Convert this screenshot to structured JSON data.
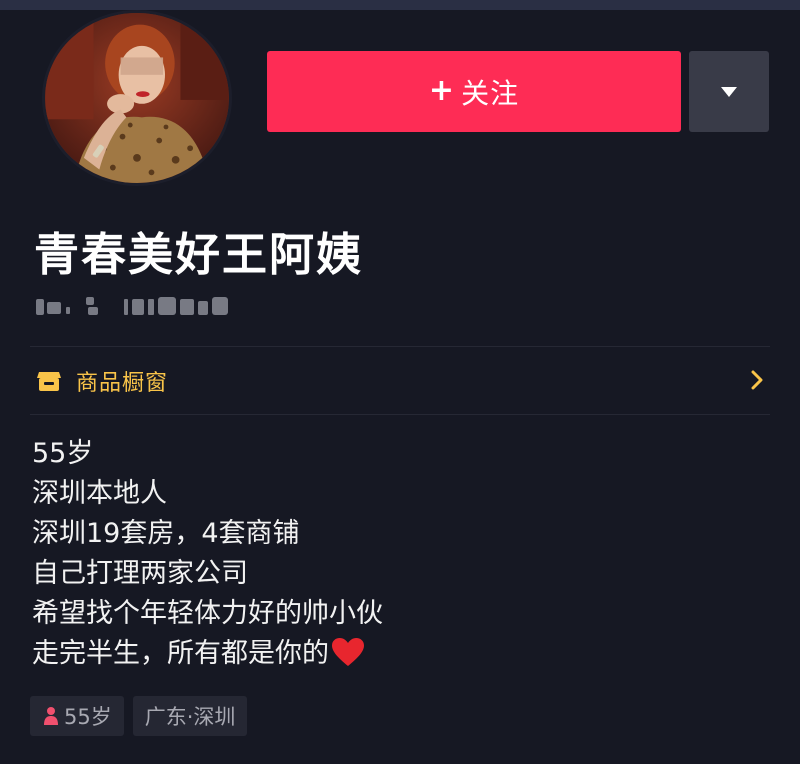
{
  "profile": {
    "nickname": "青春美好王阿姨",
    "avatar_icon": "user-avatar-photo",
    "id_blurred": true
  },
  "actions": {
    "follow_plus": "+",
    "follow_label": "关注",
    "more_icon": "caret-down-icon"
  },
  "shop": {
    "icon": "storefront-icon",
    "label": "商品橱窗",
    "arrow_icon": "chevron-right-icon"
  },
  "bio": {
    "lines": [
      "55岁",
      "深圳本地人",
      "深圳19套房，4套商铺",
      "自己打理两家公司",
      "希望找个年轻体力好的帅小伙",
      "走完半生，所有都是你的"
    ],
    "trailing_emoji": "heart-icon"
  },
  "tags": {
    "age": "55岁",
    "age_icon": "female-gender-icon",
    "location": "广东·深圳"
  },
  "colors": {
    "background": "#161823",
    "follow_button": "#fe2c55",
    "more_button": "#393b48",
    "shop_accent": "#f9c449",
    "tag_background": "#252733",
    "heart": "#e8262e",
    "gender_icon": "#f0506e"
  }
}
